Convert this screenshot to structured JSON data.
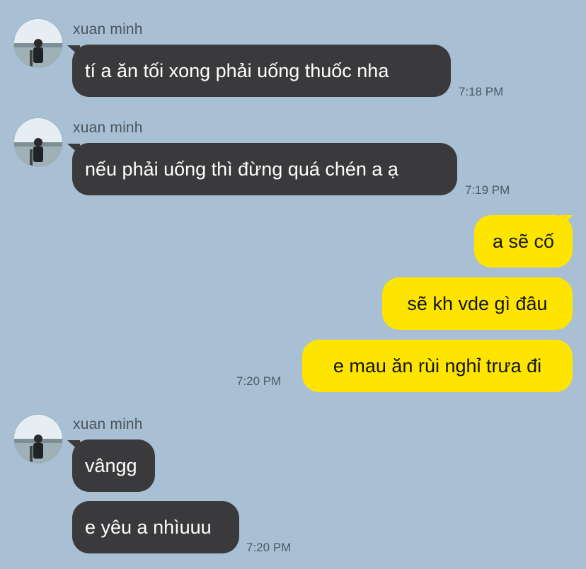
{
  "chat": {
    "groups": [
      {
        "sender": "xuan minh",
        "messages": [
          {
            "text": "tí a ăn tối xong phải uống thuốc nha",
            "time": "7:18 PM"
          }
        ]
      },
      {
        "sender": "xuan minh",
        "messages": [
          {
            "text": "nếu phải uống thì đừng quá chén a ạ",
            "time": "7:19 PM"
          }
        ]
      },
      {
        "sender": "me",
        "messages": [
          {
            "text": "a sẽ cố"
          },
          {
            "text": "sẽ kh vde gì đâu"
          },
          {
            "text": "e mau ăn rùi nghỉ trưa đi",
            "time": "7:20 PM"
          }
        ]
      },
      {
        "sender": "xuan minh",
        "messages": [
          {
            "text": "vângg"
          },
          {
            "text": "e yêu a nhìuuu",
            "time": "7:20 PM"
          }
        ]
      }
    ]
  },
  "colors": {
    "background": "#a9bfd4",
    "incoming_bubble": "#3a3a3d",
    "outgoing_bubble": "#fee500"
  }
}
